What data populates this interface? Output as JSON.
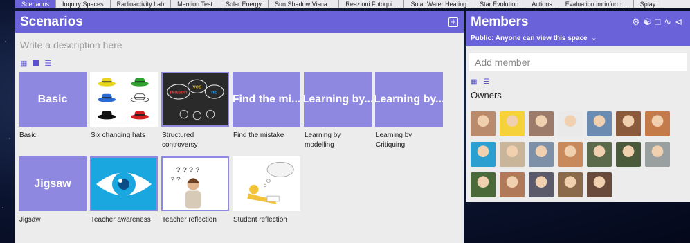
{
  "tabs": [
    "Scenarios",
    "Inquiry Spaces",
    "Radioactivity Lab",
    "Mention Test",
    "Solar Energy",
    "Sun Shadow Visua...",
    "Reazioni Fotoqui...",
    "Solar Water Heating",
    "Star Evolution",
    "Actions",
    "Evaluation im inform...",
    "Splay"
  ],
  "scenarios": {
    "title": "Scenarios",
    "plus": "+",
    "description_placeholder": "Write a description here",
    "items": [
      {
        "thumb_text": "Basic",
        "caption": "Basic"
      },
      {
        "thumb_text": "",
        "caption": "Six changing hats"
      },
      {
        "thumb_text": "",
        "caption": "Structured controversy",
        "bubble1": "reason",
        "bubble2": "yes",
        "bubble3": "no"
      },
      {
        "thumb_text": "Find the mi...",
        "caption": "Find the mistake"
      },
      {
        "thumb_text": "Learning by...",
        "caption": "Learning by modelling"
      },
      {
        "thumb_text": "Learning by...",
        "caption": "Learning by Critiquing"
      },
      {
        "thumb_text": "Jigsaw",
        "caption": "Jigsaw"
      },
      {
        "thumb_text": "",
        "caption": "Teacher awareness"
      },
      {
        "thumb_text": "",
        "caption": "Teacher reflection"
      },
      {
        "thumb_text": "",
        "caption": "Student reflection"
      }
    ]
  },
  "members": {
    "title": "Members",
    "visibility": "Public: Anyone can view this space",
    "add_placeholder": "Add member",
    "owners_label": "Owners",
    "avatar_colors": [
      "#b98a6c",
      "#f5d23a",
      "#9c7b6a",
      "#e9e9e9",
      "#6b8cb0",
      "#8a5a3c",
      "#c57a4a",
      "#2a9fd0",
      "#c9b59a",
      "#7e8fa8",
      "#c88a5a",
      "#5a6a4a",
      "#4a5a3a",
      "#9aa0a0",
      "#4a6a3a",
      "#b07a5a",
      "#5a5a6a",
      "#8a6a4a",
      "#6a4a3a"
    ]
  },
  "icons": {
    "grid": "grid-icon",
    "list": "list-icon",
    "settings": "gear-icon",
    "user": "user-icon",
    "chat": "chat-icon",
    "activity": "activity-icon",
    "share": "share-icon"
  },
  "accent": "#6a62d8"
}
